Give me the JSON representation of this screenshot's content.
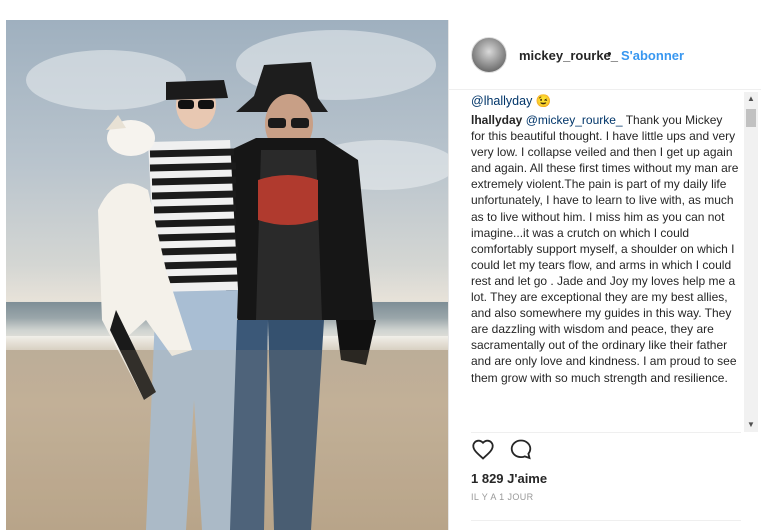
{
  "post": {
    "username": "mickey_rourke_",
    "separator": "•",
    "follow_label": "S'abonner",
    "more_icon": "more-icon"
  },
  "comments": {
    "mention": "@lhallyday",
    "mention_emoji": "😉",
    "caption_author": "lhallyday",
    "caption_tag": "@mickey_rourke_",
    "caption_text": "Thank you Mickey for this beautiful thought. I have little ups and very very low. I collapse veiled and then I get up again and again. All these first times without my man are extremely violent.The pain is part of my daily life unfortunately, I have to learn to live with, as much as to live without him. I miss him as you can not imagine...it was a crutch on which I could comfortably support myself, a shoulder on which I could let my tears flow, and arms in which I could rest and let go . Jade and Joy my loves help me a lot. They are exceptional they are my best allies, and also somewhere my guides in this way. They are dazzling with wisdom and peace, they are sacramentally out of the ordinary like their father and are only love and kindness. I am proud to see them grow with so much strength and resilience."
  },
  "scrollbar": {
    "up_arrow": "▲",
    "down_arrow": "▼"
  },
  "actions": {
    "like_icon": "heart-icon",
    "comment_icon": "comment-icon",
    "likes_count": "1 829 J'aime",
    "timestamp": "IL Y A 1 JOUR"
  }
}
